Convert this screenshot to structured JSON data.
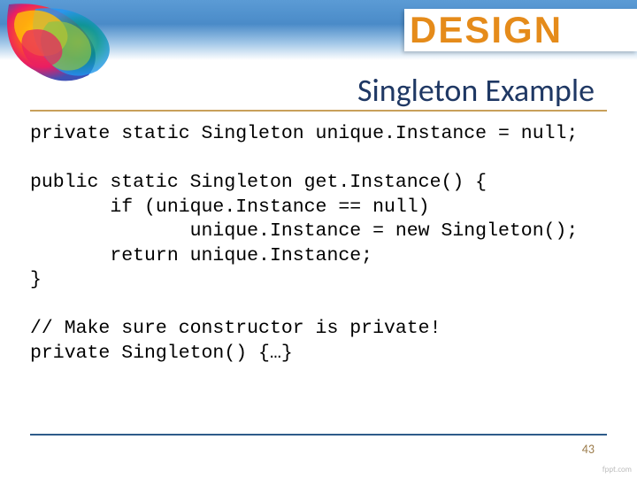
{
  "header": {
    "logo_text": "DESIGN"
  },
  "slide": {
    "title": "Singleton Example",
    "code": "private static Singleton unique.Instance = null;\n\npublic static Singleton get.Instance() {\n       if (unique.Instance == null)\n              unique.Instance = new Singleton();\n       return unique.Instance;\n}\n\n// Make sure constructor is private!\nprivate Singleton() {…}",
    "page_number": "43",
    "footer_link": "fppt.com"
  }
}
